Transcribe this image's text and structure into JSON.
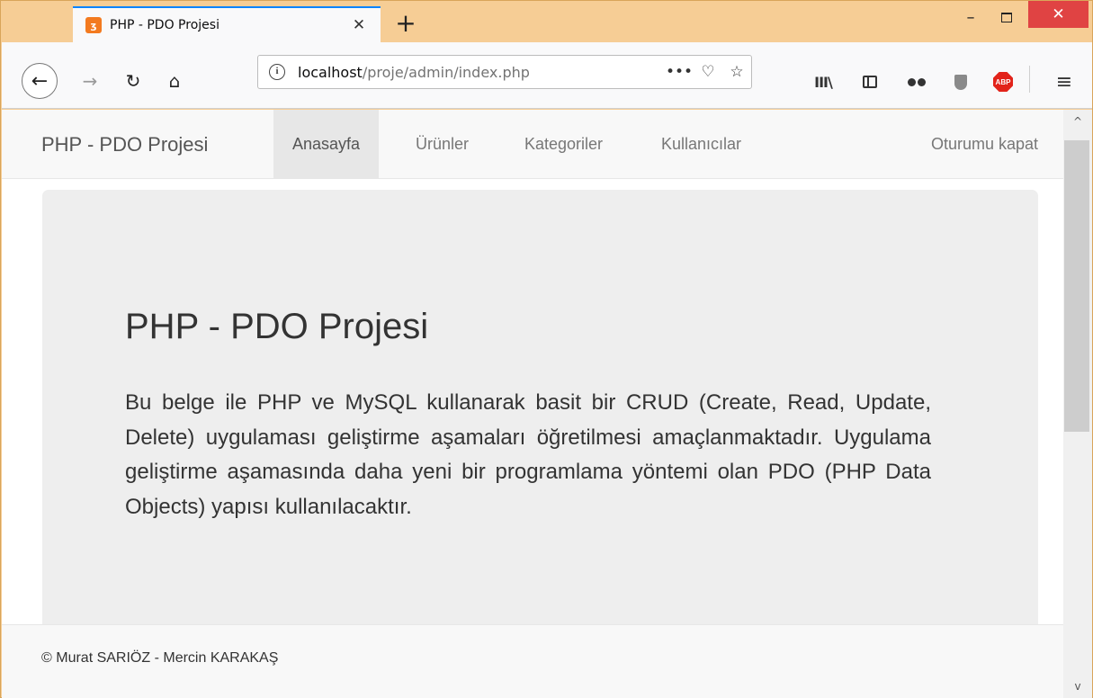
{
  "browser": {
    "tab": {
      "title": "PHP - PDO Projesi",
      "favicon": "xampp-icon",
      "close": "✕"
    },
    "new_tab": "+",
    "window_controls": {
      "minimize": "–",
      "close": "✕"
    },
    "url": {
      "host": "localhost",
      "path": "/proje/admin/index.php",
      "info": "i",
      "more": "•••",
      "pocket": "♡",
      "bookmark": "☆"
    },
    "toolbar_glyphs": {
      "back": "←",
      "forward": "→",
      "reload": "↻",
      "home": "⌂",
      "library": "III\\",
      "menu": "≡",
      "abp": "ABP"
    }
  },
  "page": {
    "navbar": {
      "brand": "PHP - PDO Projesi",
      "items": [
        {
          "label": "Anasayfa",
          "active": true
        },
        {
          "label": "Ürünler",
          "active": false
        },
        {
          "label": "Kategoriler",
          "active": false
        },
        {
          "label": "Kullanıcılar",
          "active": false
        }
      ],
      "logout": "Oturumu kapat"
    },
    "jumbotron": {
      "title": "PHP - PDO Projesi",
      "text": "Bu belge ile PHP ve MySQL kullanarak basit bir CRUD (Create, Read, Update, Delete) uygulaması geliştirme aşamaları öğretilmesi amaçlanmaktadır. Uygulama geliştirme aşamasında daha yeni bir programlama yöntemi olan PDO (PHP Data Objects) yapısı kullanılacaktır."
    },
    "footer": {
      "text": "© Murat SARIÖZ - Mercin KARAKAŞ"
    }
  },
  "colors": {
    "frame": "#f6cd95",
    "tab_accent": "#0a84ff",
    "close_button": "#e04343",
    "abp": "#e2231a",
    "jumbotron": "#eeeeee"
  }
}
